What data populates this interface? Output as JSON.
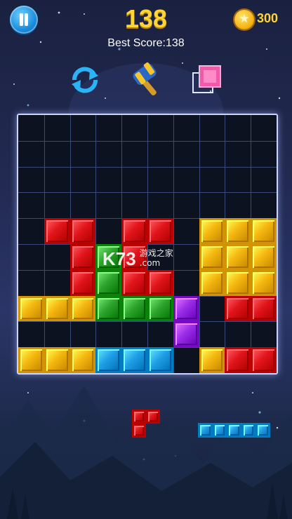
{
  "header": {
    "score": "138",
    "best_score_label": "Best Score:",
    "best_score_value": "138",
    "coins": "300"
  },
  "tools": [
    {
      "name": "refresh-icon"
    },
    {
      "name": "hammer-icon"
    },
    {
      "name": "single-block-icon"
    }
  ],
  "colors": {
    "red": "#e0141a",
    "yellow": "#f5b70f",
    "green": "#2fa52e",
    "blue": "#1e9fe6",
    "purple": "#9a2de8",
    "pink": "#f25aa9"
  },
  "board": {
    "rows": 10,
    "cols": 10,
    "cells": [
      "..........",
      "..........",
      "..........",
      "..........",
      ".RR.RR.YYY",
      "..RGR..YYY",
      "..RGRR.YYY",
      "YYYGGGP.RR",
      "......P...",
      "YYYBBB.YRR"
    ]
  },
  "pieces": [
    {
      "name": "red-corner-piece",
      "color": "red",
      "shape": [
        "RR",
        "R."
      ]
    },
    {
      "name": "blue-line-piece",
      "color": "blue",
      "shape": [
        "BBBBB"
      ]
    }
  ],
  "watermark": {
    "main": "K73",
    "sub": "游戏之家",
    "domain": ".com"
  }
}
